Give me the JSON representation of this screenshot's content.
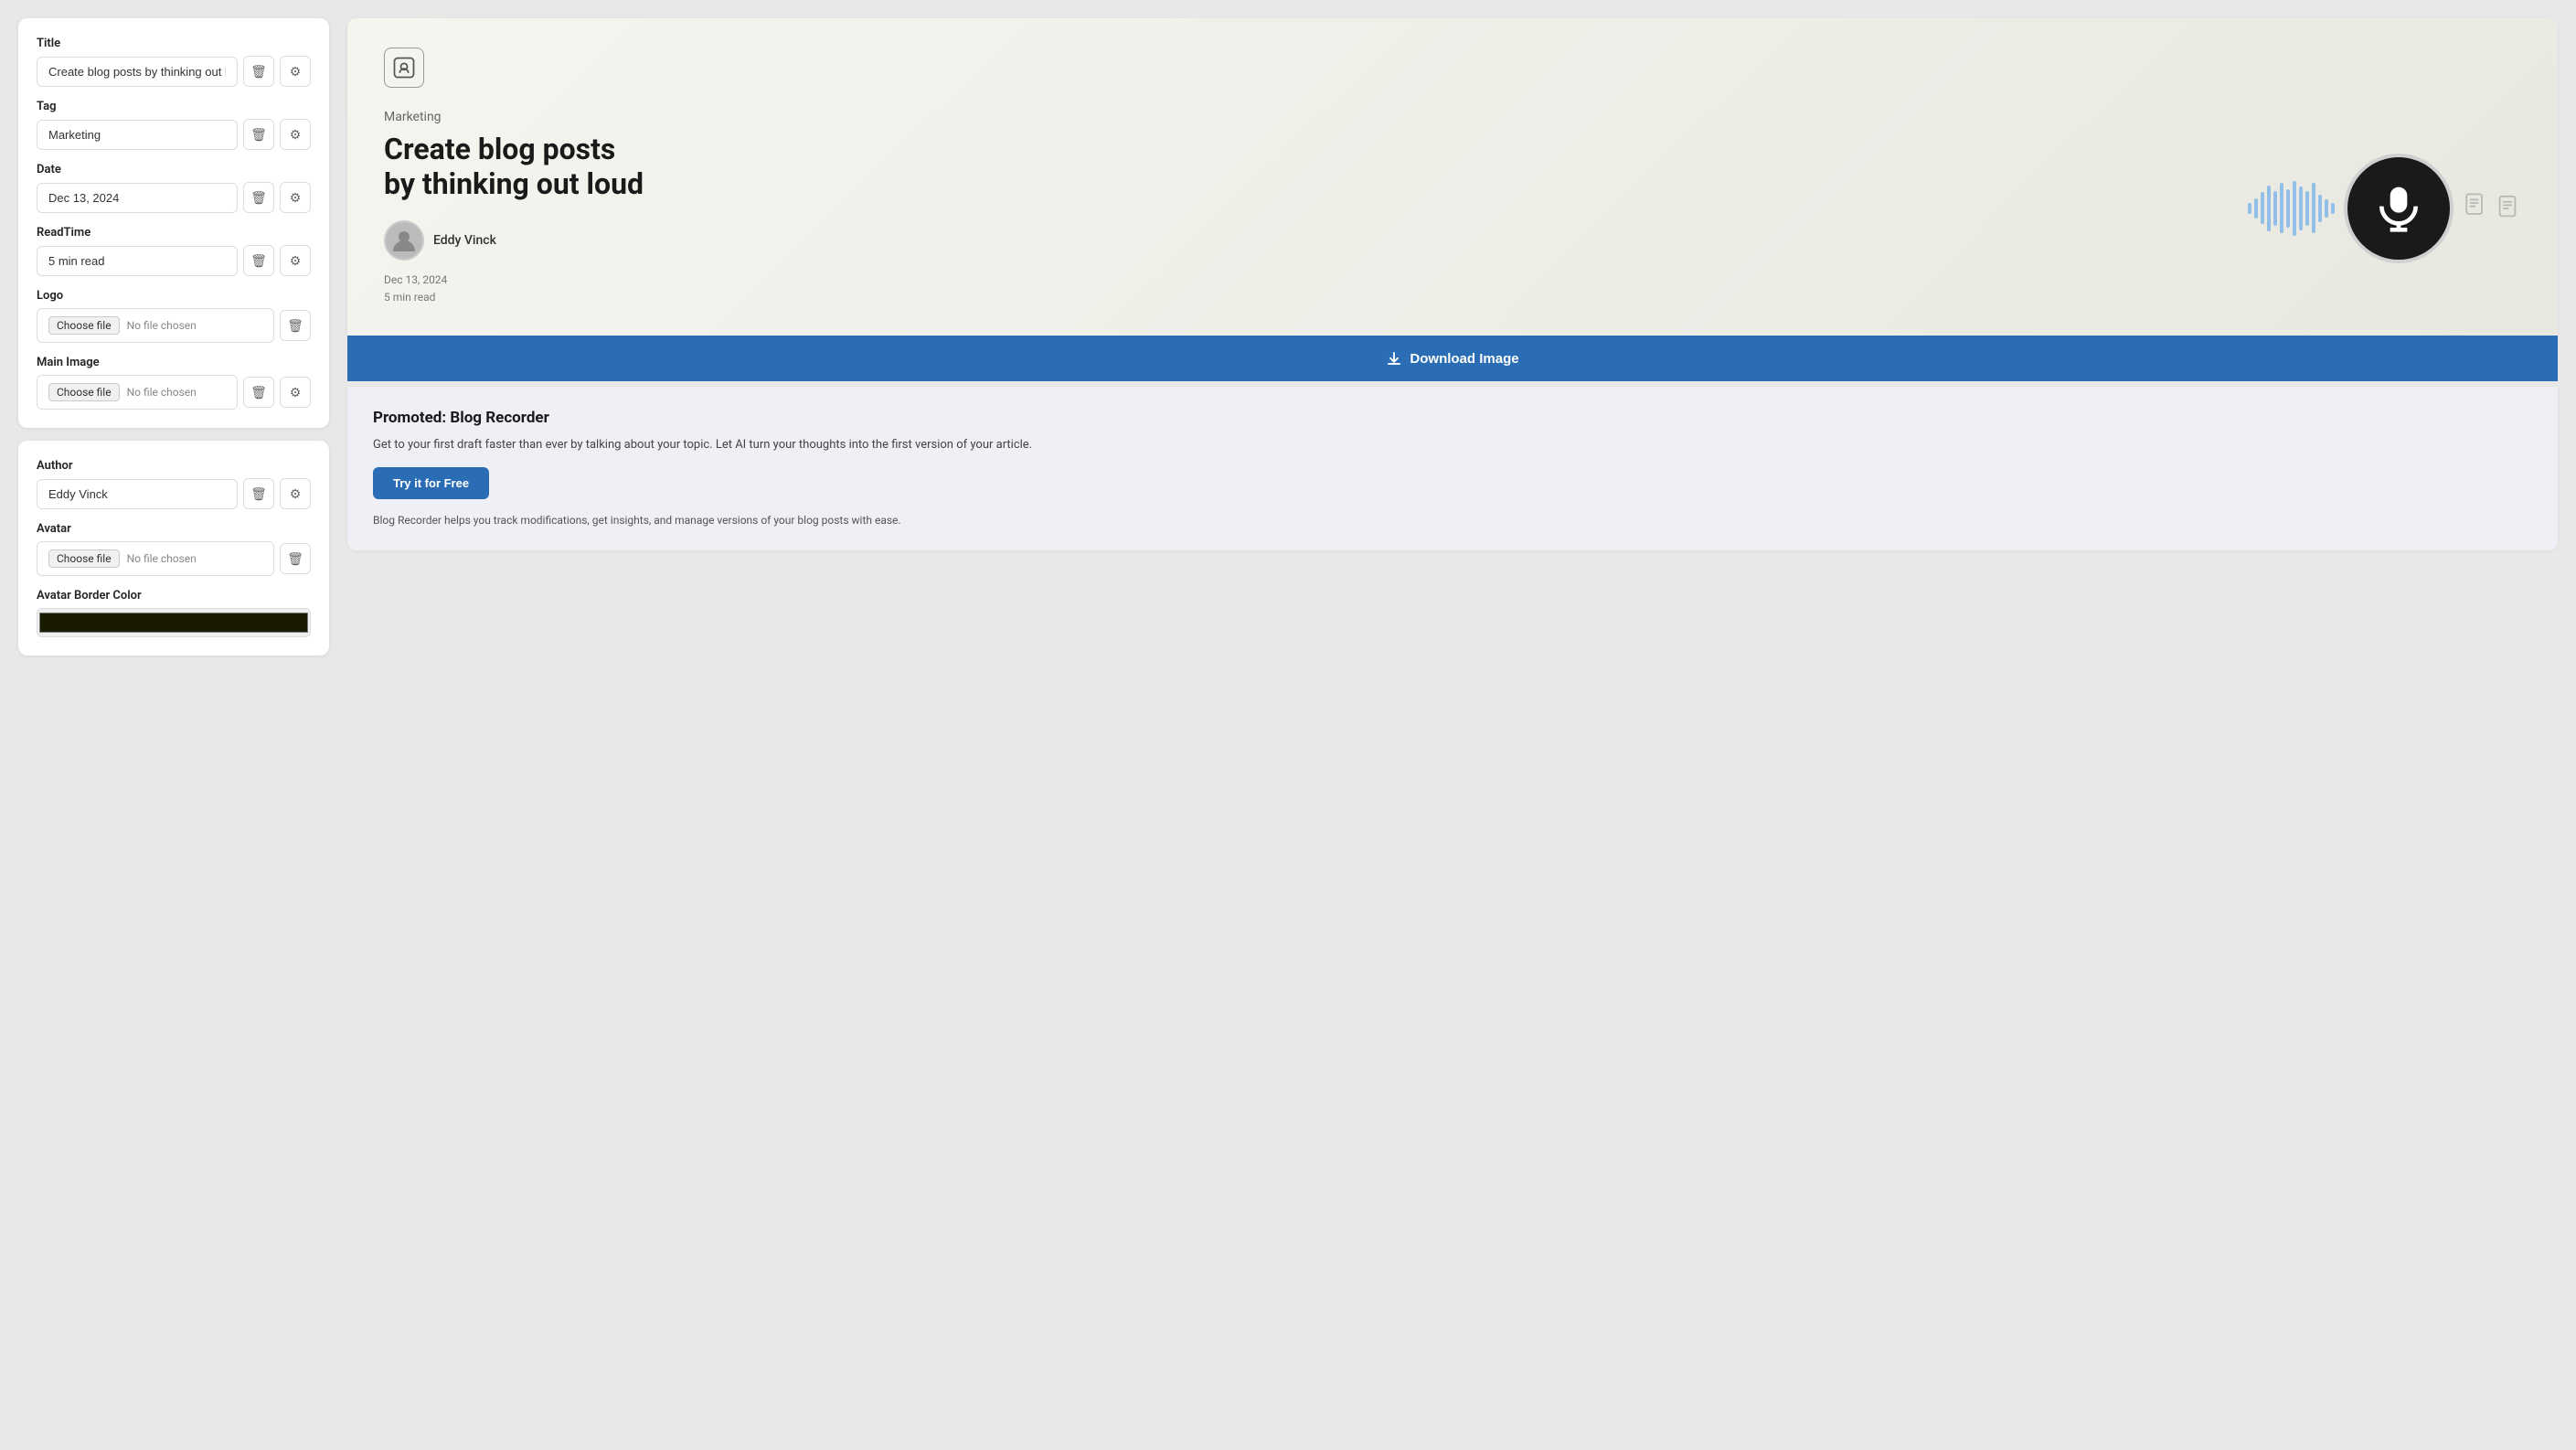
{
  "left": {
    "card1": {
      "title_label": "Title",
      "title_value": "Create blog posts by thinking out loud",
      "tag_label": "Tag",
      "tag_value": "Marketing",
      "date_label": "Date",
      "date_value": "Dec 13, 2024",
      "readtime_label": "ReadTime",
      "readtime_value": "5 min read",
      "logo_label": "Logo",
      "logo_file_btn": "Choose file",
      "logo_file_none": "No file chosen",
      "main_image_label": "Main Image",
      "main_image_file_btn": "Choose file",
      "main_image_file_none": "No file chosen"
    },
    "card2": {
      "author_label": "Author",
      "author_value": "Eddy Vinck",
      "avatar_label": "Avatar",
      "avatar_file_btn": "Choose file",
      "avatar_file_none": "No file chosen",
      "avatar_border_label": "Avatar Border Color",
      "avatar_border_color": "#1a1a00"
    }
  },
  "preview": {
    "tag": "Marketing",
    "title_line1": "Create blog posts",
    "title_line2": "by thinking out loud",
    "author": "Eddy Vinck",
    "date": "Dec 13, 2024",
    "read_time": "5 min read"
  },
  "download_btn_label": "Download Image",
  "promoted": {
    "title": "Promoted: Blog Recorder",
    "description": "Get to your first draft faster than ever by talking about your topic. Let AI turn your thoughts into the first version of your article.",
    "cta_label": "Try it for Free",
    "footer": "Blog Recorder helps you track modifications, get insights, and manage versions of your blog posts with ease."
  },
  "icons": {
    "delete": "🗑",
    "settings": "⚙",
    "download": "⬇",
    "mic": "🎙",
    "logo_mic": "🎙",
    "doc1": "📄",
    "doc2": "📋"
  },
  "wave_heights": [
    12,
    22,
    35,
    50,
    38,
    55,
    42,
    60,
    48,
    38,
    55,
    42,
    30,
    20,
    12
  ]
}
